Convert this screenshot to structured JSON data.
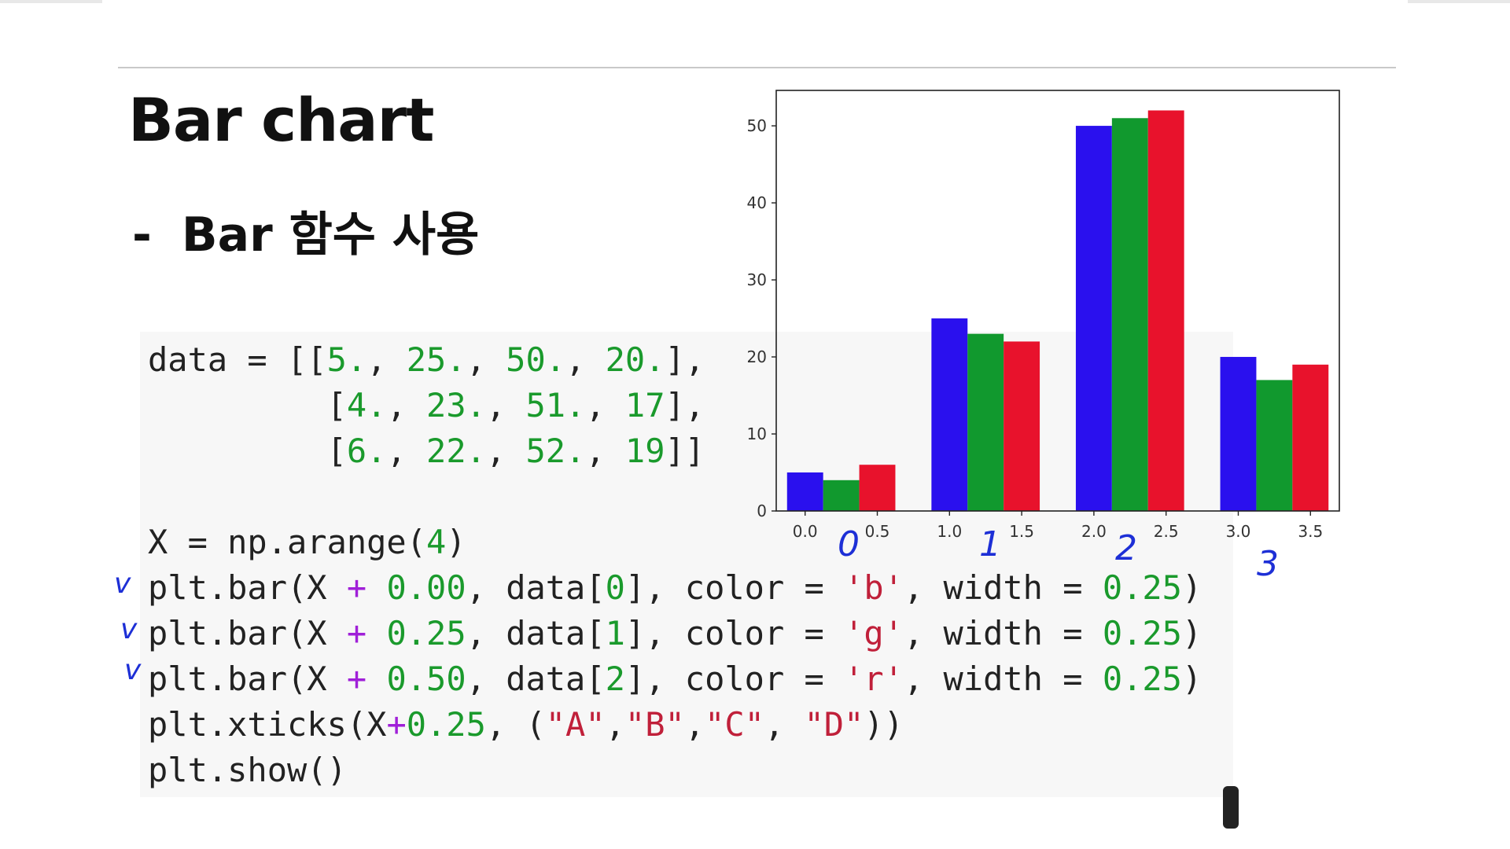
{
  "slide": {
    "title": "Bar chart",
    "subtitle_dash": "-",
    "subtitle": "Bar 함수 사용"
  },
  "code_lines": [
    [
      {
        "t": "data = [[",
        "c": "plain"
      },
      {
        "t": "5.",
        "c": "num"
      },
      {
        "t": ", ",
        "c": "plain"
      },
      {
        "t": "25.",
        "c": "num"
      },
      {
        "t": ", ",
        "c": "plain"
      },
      {
        "t": "50.",
        "c": "num"
      },
      {
        "t": ", ",
        "c": "plain"
      },
      {
        "t": "20.",
        "c": "num"
      },
      {
        "t": "],",
        "c": "plain"
      }
    ],
    [
      {
        "t": "         [",
        "c": "plain"
      },
      {
        "t": "4.",
        "c": "num"
      },
      {
        "t": ", ",
        "c": "plain"
      },
      {
        "t": "23.",
        "c": "num"
      },
      {
        "t": ", ",
        "c": "plain"
      },
      {
        "t": "51.",
        "c": "num"
      },
      {
        "t": ", ",
        "c": "plain"
      },
      {
        "t": "17",
        "c": "num"
      },
      {
        "t": "],",
        "c": "plain"
      }
    ],
    [
      {
        "t": "         [",
        "c": "plain"
      },
      {
        "t": "6.",
        "c": "num"
      },
      {
        "t": ", ",
        "c": "plain"
      },
      {
        "t": "22.",
        "c": "num"
      },
      {
        "t": ", ",
        "c": "plain"
      },
      {
        "t": "52.",
        "c": "num"
      },
      {
        "t": ", ",
        "c": "plain"
      },
      {
        "t": "19",
        "c": "num"
      },
      {
        "t": "]]",
        "c": "plain"
      }
    ],
    [
      {
        "t": "X = np.arange(",
        "c": "plain"
      },
      {
        "t": "4",
        "c": "num"
      },
      {
        "t": ")",
        "c": "plain"
      }
    ],
    [
      {
        "t": "plt.bar(X ",
        "c": "plain"
      },
      {
        "t": "+",
        "c": "op"
      },
      {
        "t": " ",
        "c": "plain"
      },
      {
        "t": "0.00",
        "c": "num"
      },
      {
        "t": ", data[",
        "c": "plain"
      },
      {
        "t": "0",
        "c": "num"
      },
      {
        "t": "], color = ",
        "c": "plain"
      },
      {
        "t": "'b'",
        "c": "str"
      },
      {
        "t": ", width = ",
        "c": "plain"
      },
      {
        "t": "0.25",
        "c": "num"
      },
      {
        "t": ")",
        "c": "plain"
      }
    ],
    [
      {
        "t": "plt.bar(X ",
        "c": "plain"
      },
      {
        "t": "+",
        "c": "op"
      },
      {
        "t": " ",
        "c": "plain"
      },
      {
        "t": "0.25",
        "c": "num"
      },
      {
        "t": ", data[",
        "c": "plain"
      },
      {
        "t": "1",
        "c": "num"
      },
      {
        "t": "], color = ",
        "c": "plain"
      },
      {
        "t": "'g'",
        "c": "str"
      },
      {
        "t": ", width = ",
        "c": "plain"
      },
      {
        "t": "0.25",
        "c": "num"
      },
      {
        "t": ")",
        "c": "plain"
      }
    ],
    [
      {
        "t": "plt.bar(X ",
        "c": "plain"
      },
      {
        "t": "+",
        "c": "op"
      },
      {
        "t": " ",
        "c": "plain"
      },
      {
        "t": "0.50",
        "c": "num"
      },
      {
        "t": ", data[",
        "c": "plain"
      },
      {
        "t": "2",
        "c": "num"
      },
      {
        "t": "], color = ",
        "c": "plain"
      },
      {
        "t": "'r'",
        "c": "str"
      },
      {
        "t": ", width = ",
        "c": "plain"
      },
      {
        "t": "0.25",
        "c": "num"
      },
      {
        "t": ")",
        "c": "plain"
      }
    ],
    [
      {
        "t": "plt.xticks(X",
        "c": "plain"
      },
      {
        "t": "+",
        "c": "op"
      },
      {
        "t": "0.25",
        "c": "num"
      },
      {
        "t": ", (",
        "c": "plain"
      },
      {
        "t": "\"A\"",
        "c": "str"
      },
      {
        "t": ",",
        "c": "plain"
      },
      {
        "t": "\"B\"",
        "c": "str"
      },
      {
        "t": ",",
        "c": "plain"
      },
      {
        "t": "\"C\"",
        "c": "str"
      },
      {
        "t": ", ",
        "c": "plain"
      },
      {
        "t": "\"D\"",
        "c": "str"
      },
      {
        "t": "))",
        "c": "plain"
      }
    ],
    [
      {
        "t": "plt.show()",
        "c": "plain"
      }
    ]
  ],
  "annotations": {
    "checks": [
      "v",
      "v",
      "v"
    ],
    "hand_numbers": [
      "0",
      "1",
      "2",
      "3"
    ]
  },
  "colors": {
    "blue": "#2a10ee",
    "green": "#11992e",
    "red": "#e8122c",
    "ink": "#1d2fd6"
  },
  "chart_data": {
    "type": "bar",
    "x": [
      0,
      1,
      2,
      3
    ],
    "bar_width": 0.25,
    "series": [
      {
        "values": [
          5,
          25,
          50,
          20
        ],
        "offset": 0.0,
        "color": "#2a10ee"
      },
      {
        "values": [
          4,
          23,
          51,
          17
        ],
        "offset": 0.25,
        "color": "#11992e"
      },
      {
        "values": [
          6,
          22,
          52,
          19
        ],
        "offset": 0.5,
        "color": "#e8122c"
      }
    ],
    "xlim": [
      -0.2,
      3.7
    ],
    "ylim": [
      0,
      54.6
    ],
    "xticks": [
      0.0,
      0.5,
      1.0,
      1.5,
      2.0,
      2.5,
      3.0,
      3.5
    ],
    "xtick_labels": [
      "0.0",
      "0.5",
      "1.0",
      "1.5",
      "2.0",
      "2.5",
      "3.0",
      "3.5"
    ],
    "yticks": [
      0,
      10,
      20,
      30,
      40,
      50
    ],
    "ytick_labels": [
      "0",
      "10",
      "20",
      "30",
      "40",
      "50"
    ],
    "title": "",
    "xlabel": "",
    "ylabel": "",
    "grid": false
  }
}
